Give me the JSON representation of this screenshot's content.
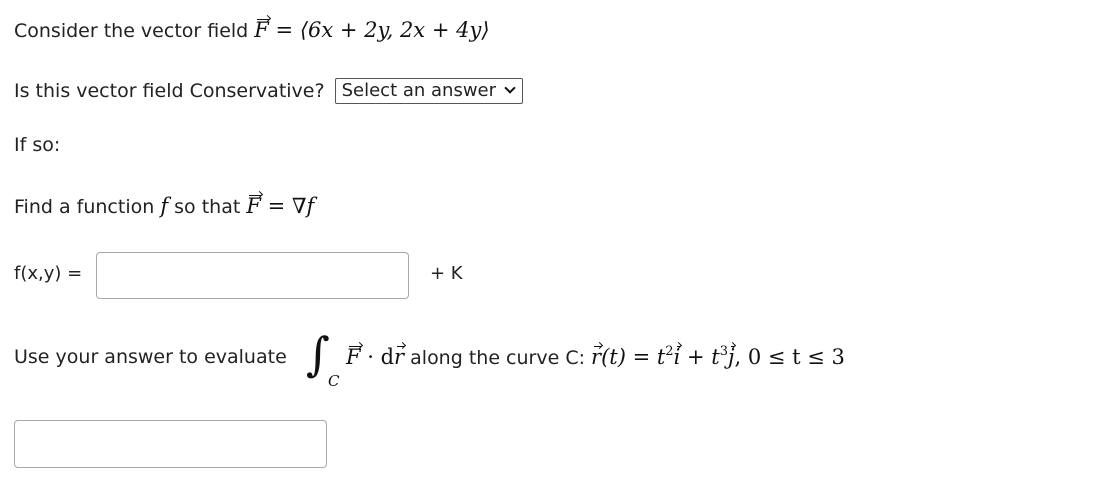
{
  "q1": {
    "prefix": "Consider the vector field ",
    "F": "F",
    "equals": " = ",
    "rhs": "⟨6x + 2y, 2x + 4y⟩"
  },
  "q2": {
    "label": "Is this vector field Conservative?",
    "select_value": "Select an answer"
  },
  "q3": {
    "label": "If so:"
  },
  "q4": {
    "prefix": "Find a function ",
    "f": "f",
    "middle": " so that ",
    "F": "F",
    "equals": " = ∇",
    "f2": "f"
  },
  "q5": {
    "label": "f(x,y) =",
    "input_value": "",
    "suffix": "+ K"
  },
  "q6": {
    "prefix": "Use your answer to evaluate",
    "integral_sign": "∫",
    "subscript": "C",
    "F": "F",
    "dot_d": " · d",
    "r": "r",
    "along": "along the curve C: ",
    "r2": "r",
    "t_part": "(t) = t",
    "exp1": "2",
    "i": "i",
    "plus": " + t",
    "exp2": "3",
    "j": "j",
    "range": ",  0 ≤ t ≤ 3"
  },
  "q7": {
    "input_value": ""
  }
}
